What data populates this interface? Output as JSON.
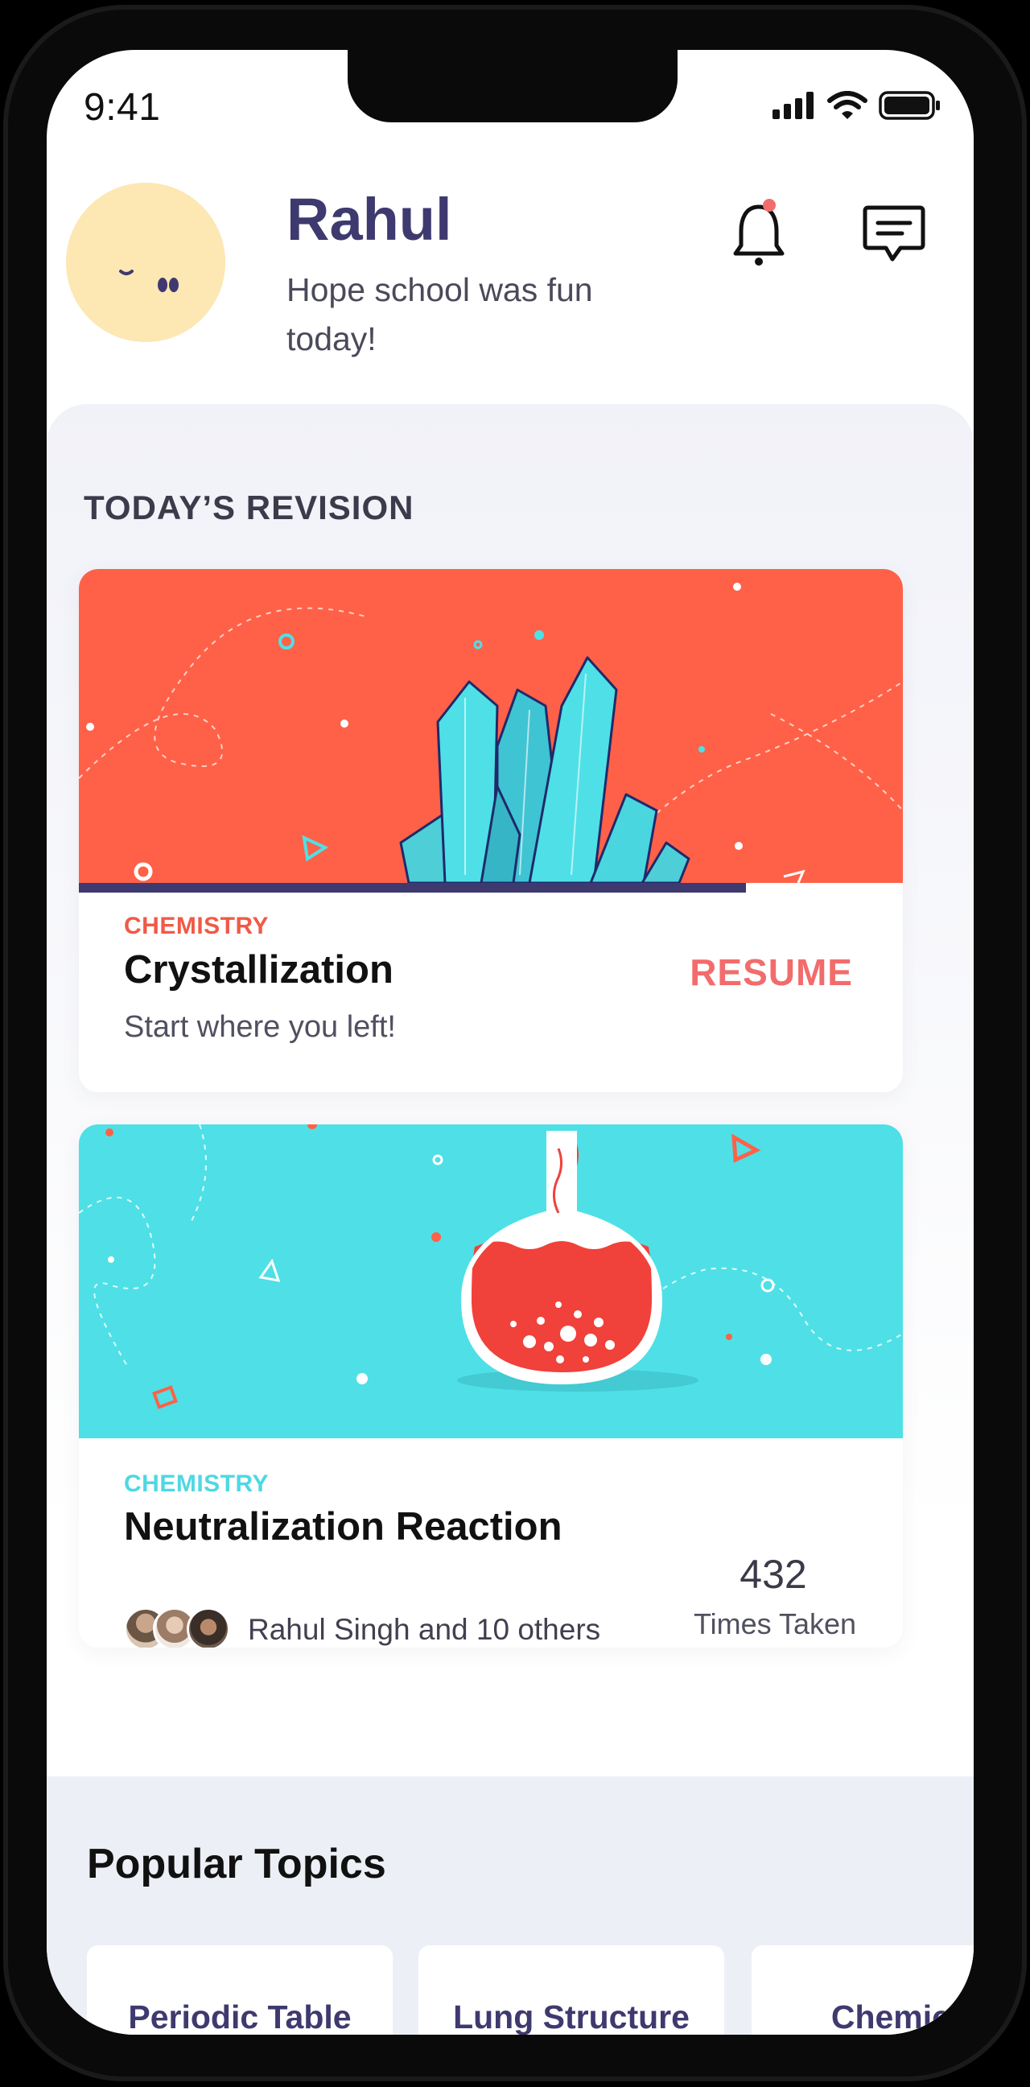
{
  "status_bar": {
    "time": "9:41"
  },
  "header": {
    "name": "Rahul",
    "subtitle": "Hope school was fun today!"
  },
  "icons": {
    "notification": "bell-icon",
    "messages": "chat-icon"
  },
  "colors": {
    "brand": "#3e3a6f",
    "coral": "#ff6148",
    "teal": "#4ee0e6",
    "resume": "#f26c6c"
  },
  "revision": {
    "section_title": "TODAY’S REVISION",
    "cards": [
      {
        "subject": "CHEMISTRY",
        "title": "Crystallization",
        "description": "Start where you left!",
        "action": "RESUME",
        "progress": 0.81
      },
      {
        "subject": "CHEMISTRY",
        "title": "Neutralization Reaction",
        "people": "Rahul Singh and 10 others",
        "times_taken_count": "432",
        "times_taken_label": "Times Taken"
      }
    ]
  },
  "popular": {
    "title": "Popular Topics",
    "topics": [
      "Periodic Table",
      "Lung Structure",
      "Chemical"
    ]
  }
}
